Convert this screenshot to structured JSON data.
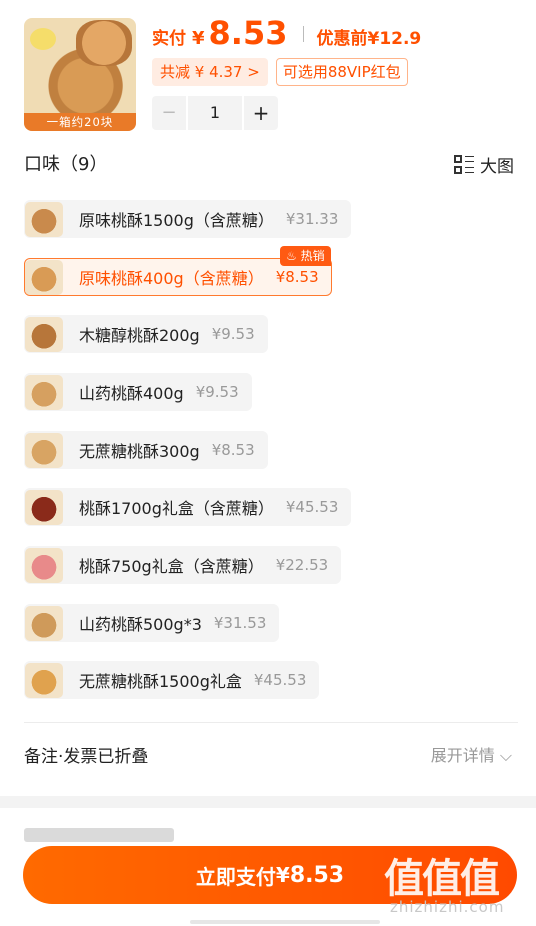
{
  "product": {
    "image_band": "一箱约20块",
    "pay_label": "实付",
    "pay_currency": "¥",
    "pay_amount": "8.53",
    "original_label": "优惠前¥12.9",
    "discount_tag": "共减 ¥ 4.37 >",
    "vip_tag": "可选用88VIP红包",
    "quantity": "1",
    "minus": "−",
    "plus": "+"
  },
  "flavor": {
    "title": "口味（9）",
    "big_view_label": "大图",
    "hot_badge": "♨ 热销",
    "options": [
      {
        "name": "原味桃酥1500g（含蔗糖）",
        "price": "¥31.33",
        "selected": false,
        "color": "#c98a4c"
      },
      {
        "name": "原味桃酥400g（含蔗糖）",
        "price": "¥8.53",
        "selected": true,
        "color": "#d99b55"
      },
      {
        "name": "木糖醇桃酥200g",
        "price": "¥9.53",
        "selected": false,
        "color": "#b7763a"
      },
      {
        "name": "山药桃酥400g",
        "price": "¥9.53",
        "selected": false,
        "color": "#d6a060"
      },
      {
        "name": "无蔗糖桃酥300g",
        "price": "¥8.53",
        "selected": false,
        "color": "#d8a463"
      },
      {
        "name": "桃酥1700g礼盒（含蔗糖）",
        "price": "¥45.53",
        "selected": false,
        "color": "#8a2a1a"
      },
      {
        "name": "桃酥750g礼盒（含蔗糖）",
        "price": "¥22.53",
        "selected": false,
        "color": "#e88a8a"
      },
      {
        "name": "山药桃酥500g*3",
        "price": "¥31.53",
        "selected": false,
        "color": "#cf9a5a"
      },
      {
        "name": "无蔗糖桃酥1500g礼盒",
        "price": "¥45.53",
        "selected": false,
        "color": "#e0a24e"
      }
    ]
  },
  "remark": {
    "label": "备注·发票已折叠",
    "expand": "展开详情 ⌵"
  },
  "pay_button": {
    "label": "立即支付",
    "currency": "¥",
    "amount": "8.53"
  },
  "watermark": {
    "chars": "值值值",
    "url": "zhizhizhi.com"
  },
  "colors": {
    "accent": "#ff5000",
    "button": "#ff6a00"
  }
}
